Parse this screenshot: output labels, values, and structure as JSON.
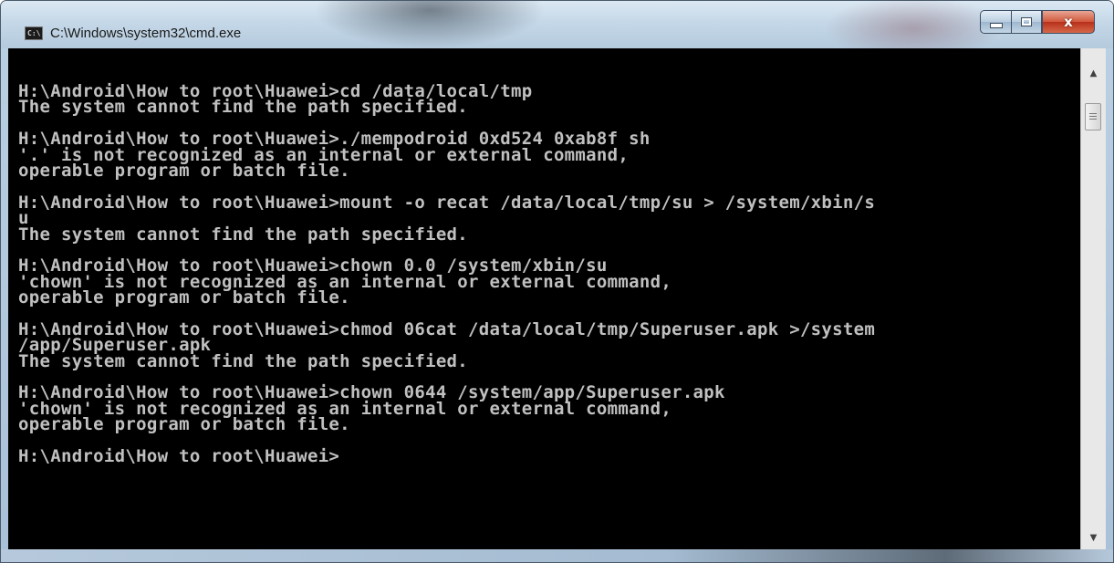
{
  "window": {
    "title": "C:\\Windows\\system32\\cmd.exe",
    "icon": "cmd-icon",
    "icon_text": "C:\\",
    "caption_buttons": {
      "minimize": "minimize-icon",
      "maximize": "maximize-icon",
      "close_label": "x"
    }
  },
  "console": {
    "lines": [
      "H:\\Android\\How to root\\Huawei>cd /data/local/tmp",
      "The system cannot find the path specified.",
      "",
      "H:\\Android\\How to root\\Huawei>./mempodroid 0xd524 0xab8f sh",
      "'.' is not recognized as an internal or external command,",
      "operable program or batch file.",
      "",
      "H:\\Android\\How to root\\Huawei>mount -o recat /data/local/tmp/su > /system/xbin/s",
      "u",
      "The system cannot find the path specified.",
      "",
      "H:\\Android\\How to root\\Huawei>chown 0.0 /system/xbin/su",
      "'chown' is not recognized as an internal or external command,",
      "operable program or batch file.",
      "",
      "H:\\Android\\How to root\\Huawei>chmod 06cat /data/local/tmp/Superuser.apk >/system",
      "/app/Superuser.apk",
      "The system cannot find the path specified.",
      "",
      "H:\\Android\\How to root\\Huawei>chown 0644 /system/app/Superuser.apk",
      "'chown' is not recognized as an internal or external command,",
      "operable program or batch file.",
      "",
      "H:\\Android\\How to root\\Huawei>"
    ]
  },
  "colors": {
    "console_bg": "#000000",
    "console_fg": "#c0c0c0",
    "close_button": "#c7432a"
  },
  "scrollbar": {
    "up_icon": "scroll-up-arrow-icon",
    "down_icon": "scroll-down-arrow-icon"
  }
}
